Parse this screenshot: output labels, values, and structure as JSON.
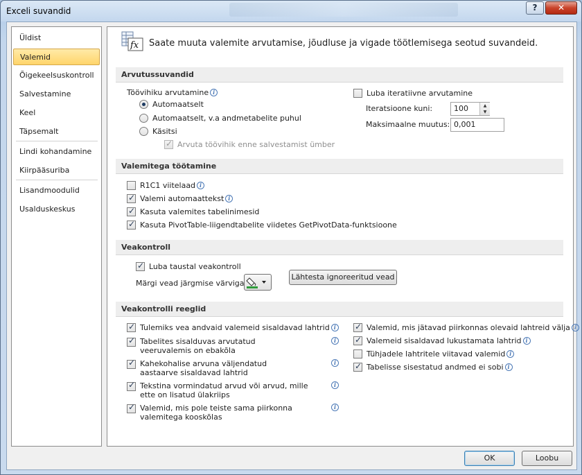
{
  "window": {
    "title": "Exceli suvandid",
    "help": "?",
    "close": "✕"
  },
  "nav": {
    "items": [
      {
        "label": "Üldist"
      },
      {
        "label": "Valemid"
      },
      {
        "label": "Õigekeelsuskontroll"
      },
      {
        "label": "Salvestamine"
      },
      {
        "label": "Keel"
      },
      {
        "label": "Täpsemalt"
      },
      {
        "label": "Lindi kohandamine"
      },
      {
        "label": "Kiirpääsuriba"
      },
      {
        "label": "Lisandmoodulid"
      },
      {
        "label": "Usalduskeskus"
      }
    ],
    "selected": "Valemid"
  },
  "header": {
    "text": "Saate muuta valemite arvutamise, jõudluse ja vigade töötlemisega seotud suvandeid."
  },
  "calc": {
    "title": "Arvutussuvandid",
    "workbook_label": "Töövihiku arvutamine",
    "radio_auto": "Automaatselt",
    "radio_auto_except": "Automaatselt, v.a andmetabelite puhul",
    "radio_manual": "Käsitsi",
    "recalc_before_save": "Arvuta töövihik enne salvestamist ümber",
    "iterative": "Luba iteratiivne arvutamine",
    "max_iter_label": "Iteratsioone kuni:",
    "max_iter_value": "100",
    "max_change_label": "Maksimaalne muutus:",
    "max_change_value": "0,001"
  },
  "working": {
    "title": "Valemitega töötamine",
    "r1c1": "R1C1 viitelaad",
    "autocomplete": "Valemi automaattekst",
    "table_names": "Kasuta valemites tabelinimesid",
    "getpivot": "Kasuta PivotTable-liigendtabelite viidetes GetPivotData-funktsioone"
  },
  "errcheck": {
    "title": "Veakontroll",
    "enable_bg": "Luba taustal veakontroll",
    "color_label": "Märgi vead järgmise värviga:",
    "reset_button": "Lähtesta ignoreeritud vead",
    "color_accent": "#2e9a3a"
  },
  "rules": {
    "title": "Veakontrolli reeglid",
    "left": [
      {
        "label": "Tulemiks vea andvaid valemeid sisaldavad lahtrid",
        "checked": true
      },
      {
        "label": "Tabelites sisalduvas arvutatud veeruvalemis on ebakõla",
        "checked": true
      },
      {
        "label": "Kahekohalise arvuna väljendatud aastaarve sisaldavad lahtrid",
        "checked": true
      },
      {
        "label": "Tekstina vormindatud arvud või arvud, mille ette on lisatud ülakriips",
        "checked": true
      },
      {
        "label": "Valemid, mis pole teiste sama piirkonna valemitega kooskõlas",
        "checked": true
      }
    ],
    "right": [
      {
        "label": "Valemid, mis jätavad piirkonnas olevaid lahtreid välja",
        "checked": true
      },
      {
        "label": "Valemeid sisaldavad lukustamata lahtrid",
        "checked": true
      },
      {
        "label": "Tühjadele lahtritele viitavad valemid",
        "checked": false
      },
      {
        "label": "Tabelisse sisestatud andmed ei sobi",
        "checked": true
      }
    ]
  },
  "footer": {
    "ok": "OK",
    "cancel": "Loobu"
  }
}
